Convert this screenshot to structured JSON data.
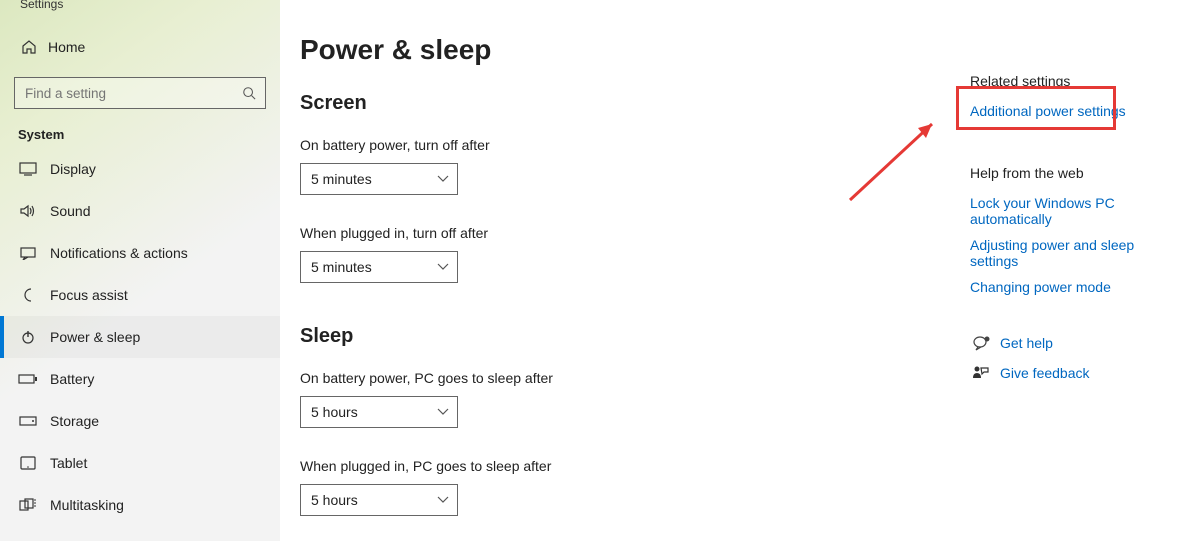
{
  "window_title": "Settings",
  "search_placeholder": "Find a setting",
  "home_label": "Home",
  "category_label": "System",
  "nav": [
    {
      "key": "display",
      "label": "Display"
    },
    {
      "key": "sound",
      "label": "Sound"
    },
    {
      "key": "notifications",
      "label": "Notifications & actions"
    },
    {
      "key": "focus",
      "label": "Focus assist"
    },
    {
      "key": "power",
      "label": "Power & sleep"
    },
    {
      "key": "battery",
      "label": "Battery"
    },
    {
      "key": "storage",
      "label": "Storage"
    },
    {
      "key": "tablet",
      "label": "Tablet"
    },
    {
      "key": "multitasking",
      "label": "Multitasking"
    }
  ],
  "page_title": "Power & sleep",
  "sections": {
    "screen": {
      "title": "Screen",
      "battery_label": "On battery power, turn off after",
      "battery_value": "5 minutes",
      "plugged_label": "When plugged in, turn off after",
      "plugged_value": "5 minutes"
    },
    "sleep": {
      "title": "Sleep",
      "battery_label": "On battery power, PC goes to sleep after",
      "battery_value": "5 hours",
      "plugged_label": "When plugged in, PC goes to sleep after",
      "plugged_value": "5 hours"
    }
  },
  "right": {
    "related_heading": "Related settings",
    "related_link": "Additional power settings",
    "help_heading": "Help from the web",
    "help_links": [
      "Lock your Windows PC automatically",
      "Adjusting power and sleep settings",
      "Changing power mode"
    ],
    "get_help": "Get help",
    "give_feedback": "Give feedback"
  }
}
